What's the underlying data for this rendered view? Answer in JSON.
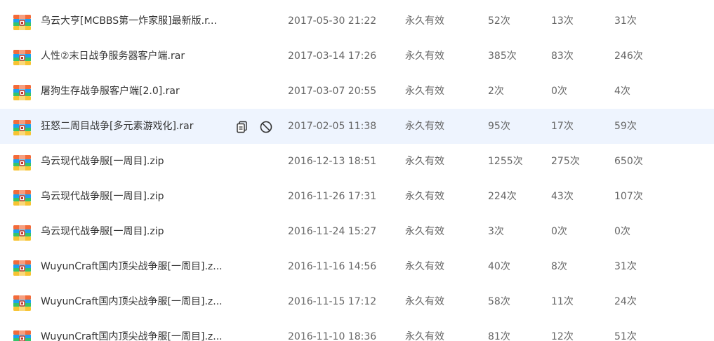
{
  "shares": [
    {
      "name": "乌云大亨[MCBBS第一炸家服]最新版.r...",
      "date": "2017-05-30 21:22",
      "validity": "永久有效",
      "views": "52次",
      "saves": "13次",
      "downloads": "31次"
    },
    {
      "name": "人性②末日战争服务器客户端.rar",
      "date": "2017-03-14 17:26",
      "validity": "永久有效",
      "views": "385次",
      "saves": "83次",
      "downloads": "246次"
    },
    {
      "name": "屠狗生存战争服客户端[2.0].rar",
      "date": "2017-03-07 20:55",
      "validity": "永久有效",
      "views": "2次",
      "saves": "0次",
      "downloads": "4次"
    },
    {
      "name": "狂怒二周目战争[多元素游戏化].rar",
      "date": "2017-02-05 11:38",
      "validity": "永久有效",
      "views": "95次",
      "saves": "17次",
      "downloads": "59次"
    },
    {
      "name": "乌云现代战争服[一周目].zip",
      "date": "2016-12-13 18:51",
      "validity": "永久有效",
      "views": "1255次",
      "saves": "275次",
      "downloads": "650次"
    },
    {
      "name": "乌云现代战争服[一周目].zip",
      "date": "2016-11-26 17:31",
      "validity": "永久有效",
      "views": "224次",
      "saves": "43次",
      "downloads": "107次"
    },
    {
      "name": "乌云现代战争服[一周目].zip",
      "date": "2016-11-24 15:27",
      "validity": "永久有效",
      "views": "3次",
      "saves": "0次",
      "downloads": "0次"
    },
    {
      "name": "WuyunCraft国内顶尖战争服[一周目].z...",
      "date": "2016-11-16 14:56",
      "validity": "永久有效",
      "views": "40次",
      "saves": "8次",
      "downloads": "31次"
    },
    {
      "name": "WuyunCraft国内顶尖战争服[一周目].z...",
      "date": "2016-11-15 17:12",
      "validity": "永久有效",
      "views": "58次",
      "saves": "11次",
      "downloads": "24次"
    },
    {
      "name": "WuyunCraft国内顶尖战争服[一周目].z...",
      "date": "2016-11-10 18:36",
      "validity": "永久有效",
      "views": "81次",
      "saves": "12次",
      "downloads": "51次"
    }
  ],
  "hovered_row": 3,
  "icons": {
    "file": "archive-file-icon",
    "copy_link": "copy-link-icon",
    "cancel_share": "cancel-share-icon"
  },
  "colors": {
    "hover_background": "#eef4fe",
    "primary_text": "#333333",
    "secondary_text": "#666666"
  }
}
